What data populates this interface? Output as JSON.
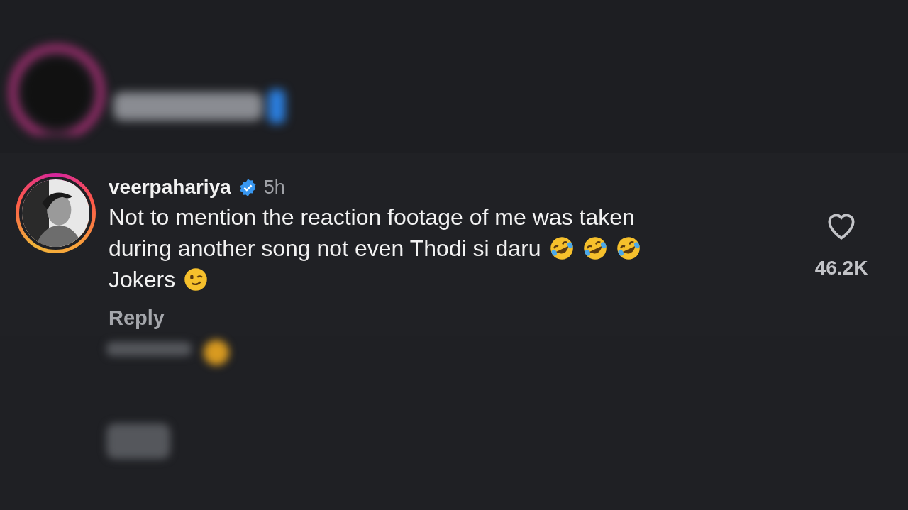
{
  "comment": {
    "username": "veerpahariya",
    "verified": true,
    "time": "5h",
    "lines": [
      {
        "parts": [
          {
            "kind": "text",
            "text": "Not to mention the reaction footage of me was taken"
          }
        ]
      },
      {
        "parts": [
          {
            "kind": "text",
            "text": "during another song not even Thodi si daru"
          },
          {
            "kind": "laugh_emoji"
          },
          {
            "kind": "laugh_emoji"
          },
          {
            "kind": "laugh_emoji"
          }
        ]
      },
      {
        "parts": [
          {
            "kind": "text",
            "text": "Jokers"
          },
          {
            "kind": "wink_emoji"
          }
        ]
      }
    ],
    "reply": "Reply",
    "liked": false,
    "likes": "46.2K"
  }
}
